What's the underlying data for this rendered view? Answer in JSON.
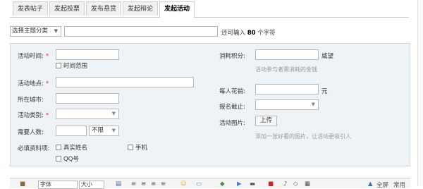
{
  "tabs": [
    {
      "label": "发表帖子"
    },
    {
      "label": "发起投票"
    },
    {
      "label": "发布悬赏"
    },
    {
      "label": "发起辩论"
    },
    {
      "label": "发起活动"
    }
  ],
  "subject": {
    "category_select": "选择主题分类",
    "title_value": "",
    "hint_prefix": "还可输入",
    "hint_count": "80",
    "hint_suffix": "个字符"
  },
  "form": {
    "time_label": "活动时间:",
    "time_range_label": "时间范围",
    "place_label": "活动地点:",
    "city_label": "所在城市:",
    "type_label": "活动类别:",
    "people_label": "需要人数:",
    "people_unlimited": "不限",
    "required_info_label": "必填资料项:",
    "real_name_label": "真实姓名",
    "phone_label": "手机",
    "qq_label": "QQ号",
    "cost_label": "消耗积分:",
    "cost_unit": "威望",
    "cost_hint": "活动参与者需消耗的金钱",
    "fee_label": "每人花销:",
    "fee_unit": "元",
    "deadline_label": "报名截止:",
    "image_label": "活动图片:",
    "upload_button": "上传",
    "image_hint": "添加一张好看的图片，让活动更吸引人"
  },
  "editor": {
    "font_select": "字体",
    "size_select": "大小",
    "fullscreen": "全屏",
    "common": "常用"
  }
}
